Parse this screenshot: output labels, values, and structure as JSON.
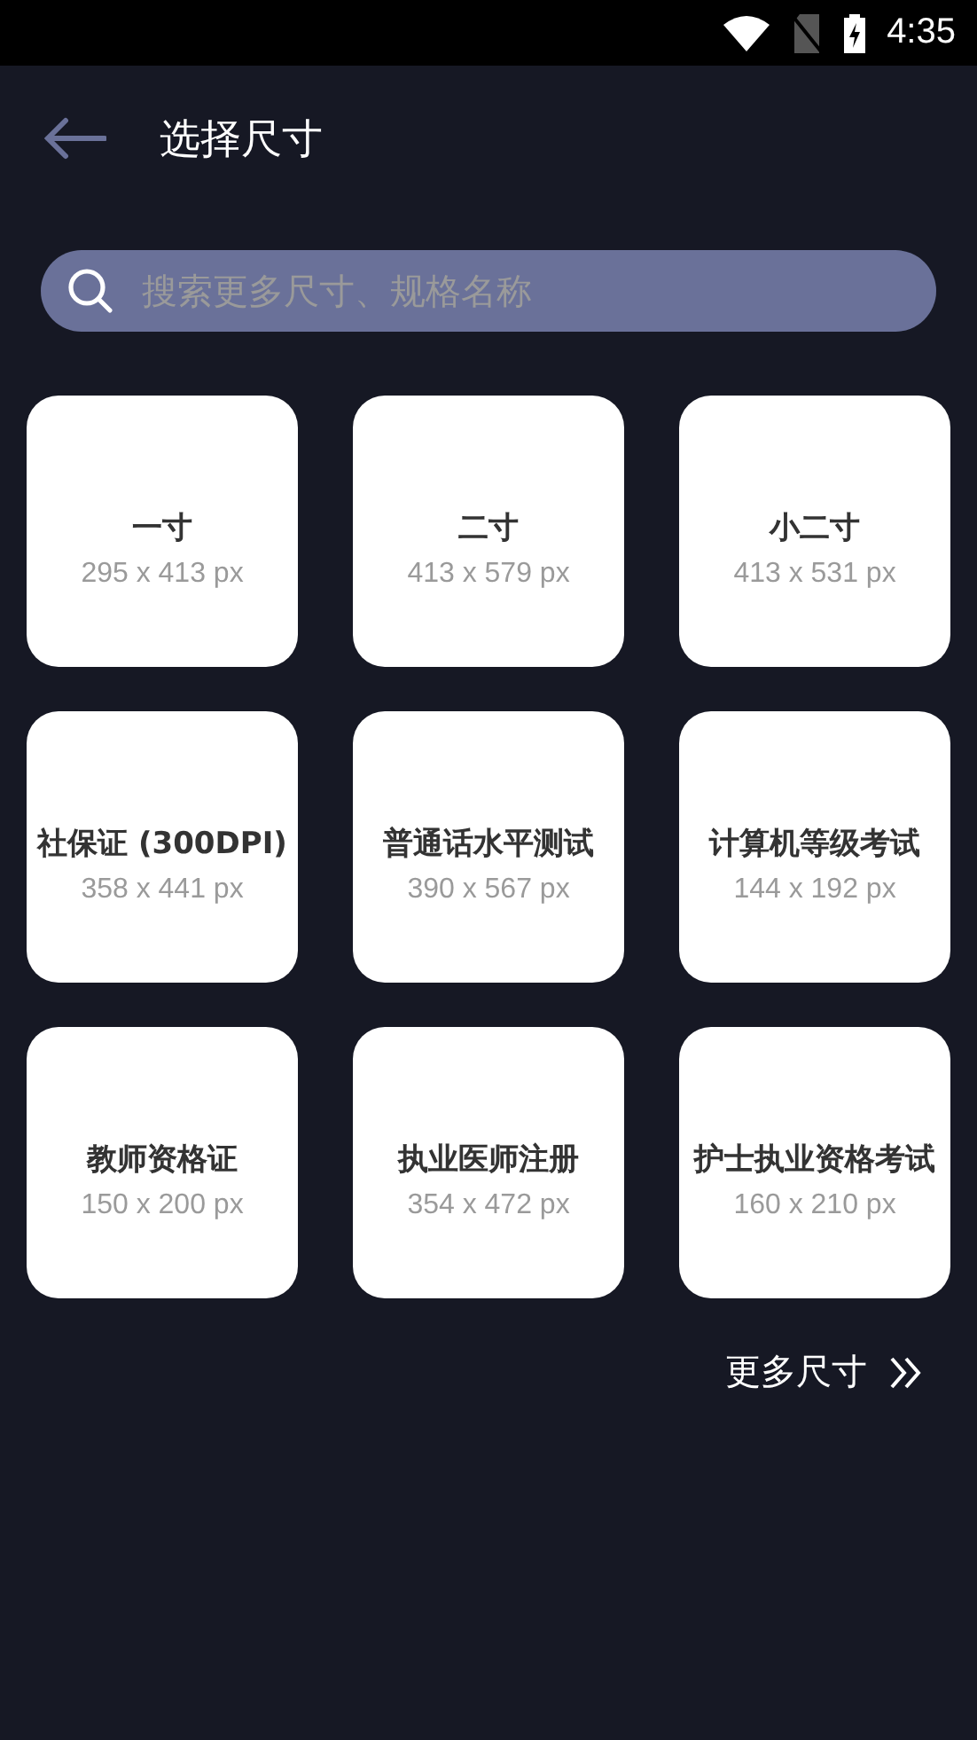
{
  "status_bar": {
    "time": "4:35"
  },
  "header": {
    "title": "选择尺寸"
  },
  "search": {
    "placeholder": "搜索更多尺寸、规格名称"
  },
  "sizes": [
    {
      "name": "一寸",
      "pixels": "295 x 413 px"
    },
    {
      "name": "二寸",
      "pixels": "413 x 579 px"
    },
    {
      "name": "小二寸",
      "pixels": "413 x 531 px"
    },
    {
      "name": "社保证 (300DPI)",
      "pixels": "358 x 441 px"
    },
    {
      "name": "普通话水平测试",
      "pixels": "390 x 567 px"
    },
    {
      "name": "计算机等级考试",
      "pixels": "144 x 192 px"
    },
    {
      "name": "教师资格证",
      "pixels": "150 x 200 px"
    },
    {
      "name": "执业医师注册",
      "pixels": "354 x 472 px"
    },
    {
      "name": "护士执业资格考试",
      "pixels": "160 x 210 px"
    }
  ],
  "more_link": {
    "label": "更多尺寸"
  }
}
